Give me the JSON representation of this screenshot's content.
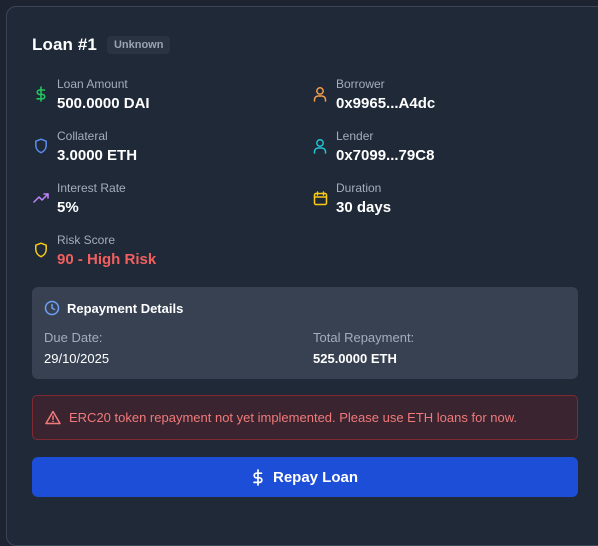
{
  "loan": {
    "title": "Loan #1",
    "status": "Unknown"
  },
  "fields": {
    "loan_amount": {
      "label": "Loan Amount",
      "value": "500.0000 DAI",
      "icon": "dollar-icon",
      "color": "#22c55e"
    },
    "borrower": {
      "label": "Borrower",
      "value": "0x9965...A4dc",
      "icon": "user-icon",
      "color": "#f59e4b"
    },
    "collateral": {
      "label": "Collateral",
      "value": "3.0000 ETH",
      "icon": "shield-icon",
      "color": "#5b8def"
    },
    "lender": {
      "label": "Lender",
      "value": "0x7099...79C8",
      "icon": "user-icon",
      "color": "#22c3d6"
    },
    "interest_rate": {
      "label": "Interest Rate",
      "value": "5%",
      "icon": "trending-up-icon",
      "color": "#c084fc"
    },
    "duration": {
      "label": "Duration",
      "value": "30 days",
      "icon": "calendar-icon",
      "color": "#facc15"
    },
    "risk_score": {
      "label": "Risk Score",
      "value": "90 - High Risk",
      "icon": "shield-alert-icon",
      "color": "#facc15",
      "value_color": "#f25f5f"
    }
  },
  "repayment": {
    "title": "Repayment Details",
    "icon": "clock-icon",
    "due_label": "Due Date:",
    "due_value": "29/10/2025",
    "total_label": "Total Repayment:",
    "total_value": "525.0000 ETH"
  },
  "alert": {
    "icon": "warning-icon",
    "text": "ERC20 token repayment not yet implemented. Please use ETH loans for now.",
    "color": "#f07a7a"
  },
  "action": {
    "label": "Repay Loan",
    "icon": "dollar-icon",
    "color": "#1d4ed8"
  }
}
